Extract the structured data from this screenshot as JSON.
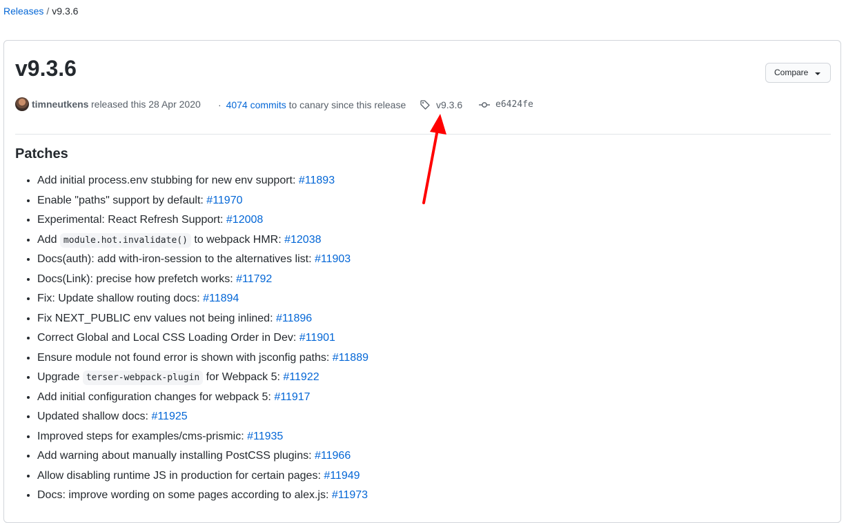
{
  "breadcrumb": {
    "parent": "Releases",
    "separator": "/",
    "current": "v9.3.6"
  },
  "release": {
    "title": "v9.3.6",
    "compare_label": "Compare",
    "author": "timneutkens",
    "released_text": "released this 28 Apr 2020",
    "commits_prefix": "·",
    "commits_link": "4074 commits",
    "commits_suffix": "to canary since this release",
    "tag": "v9.3.6",
    "commit_sha": "e6424fe",
    "icons": {
      "tag": "tag-icon",
      "commit": "git-commit-icon",
      "compare": "chevron-down-icon"
    }
  },
  "section": {
    "title": "Patches"
  },
  "patches": [
    {
      "text": "Add initial process.env stubbing for new env support: ",
      "link": "#11893"
    },
    {
      "text": "Enable \"paths\" support by default: ",
      "link": "#11970"
    },
    {
      "text": "Experimental: React Refresh Support: ",
      "link": "#12008"
    },
    {
      "text": "Add ",
      "code": "module.hot.invalidate()",
      "after": " to webpack HMR: ",
      "link": "#12038"
    },
    {
      "text": "Docs(auth): add with-iron-session to the alternatives list: ",
      "link": "#11903"
    },
    {
      "text": "Docs(Link): precise how prefetch works: ",
      "link": "#11792"
    },
    {
      "text": "Fix: Update shallow routing docs: ",
      "link": "#11894"
    },
    {
      "text": "Fix NEXT_PUBLIC env values not being inlined: ",
      "link": "#11896"
    },
    {
      "text": "Correct Global and Local CSS Loading Order in Dev: ",
      "link": "#11901"
    },
    {
      "text": "Ensure module not found error is shown with jsconfig paths: ",
      "link": "#11889"
    },
    {
      "text": "Upgrade ",
      "code": "terser-webpack-plugin",
      "after": " for Webpack 5: ",
      "link": "#11922"
    },
    {
      "text": "Add initial configuration changes for webpack 5: ",
      "link": "#11917"
    },
    {
      "text": "Updated shallow docs: ",
      "link": "#11925"
    },
    {
      "text": "Improved steps for examples/cms-prismic: ",
      "link": "#11935"
    },
    {
      "text": "Add warning about manually installing PostCSS plugins: ",
      "link": "#11966"
    },
    {
      "text": "Allow disabling runtime JS in production for certain pages: ",
      "link": "#11949"
    },
    {
      "text": "Docs: improve wording on some pages according to alex.js: ",
      "link": "#11973"
    }
  ],
  "colors": {
    "link": "#0366d6",
    "annotation_arrow": "#ff0000"
  }
}
